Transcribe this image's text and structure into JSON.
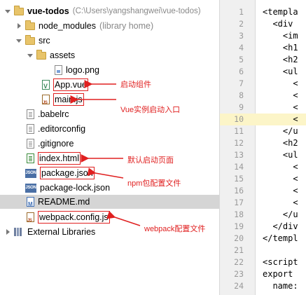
{
  "tree": {
    "project": {
      "name": "vue-todos",
      "path": "C:\\Users\\yangshangwei\\vue-todos"
    },
    "node_modules": {
      "name": "node_modules",
      "note": "library home"
    },
    "src": {
      "name": "src"
    },
    "assets": {
      "name": "assets"
    },
    "logo": {
      "name": "logo.png"
    },
    "app_vue": {
      "name": "App.vue"
    },
    "main_js": {
      "name": "main.js"
    },
    "babelrc": {
      "name": ".babelrc"
    },
    "editorconfig": {
      "name": ".editorconfig"
    },
    "gitignore": {
      "name": ".gitignore"
    },
    "index_html": {
      "name": "index.html"
    },
    "package_json": {
      "name": "package.json"
    },
    "package_lock": {
      "name": "package-lock.json"
    },
    "readme": {
      "name": "README.md"
    },
    "webpack_config": {
      "name": "webpack.config.js"
    },
    "external_libraries": {
      "name": "External Libraries"
    }
  },
  "annotations": {
    "app_vue": "启动组件",
    "main_js": "Vue实例启动入口",
    "index_html": "默认启动页面",
    "package_json": "npm包配置文件",
    "webpack_config": "webpack配置文件"
  },
  "editor": {
    "current_line": 10,
    "lines": [
      {
        "n": "1",
        "text": "<templa"
      },
      {
        "n": "2",
        "text": "  <div"
      },
      {
        "n": "3",
        "text": "    <im"
      },
      {
        "n": "4",
        "text": "    <h1"
      },
      {
        "n": "5",
        "text": "    <h2"
      },
      {
        "n": "6",
        "text": "    <ul"
      },
      {
        "n": "7",
        "text": "      <"
      },
      {
        "n": "8",
        "text": "      <"
      },
      {
        "n": "9",
        "text": "      <"
      },
      {
        "n": "10",
        "text": "      <"
      },
      {
        "n": "11",
        "text": "    </u"
      },
      {
        "n": "12",
        "text": "    <h2"
      },
      {
        "n": "13",
        "text": "    <ul"
      },
      {
        "n": "14",
        "text": "      <"
      },
      {
        "n": "15",
        "text": "      <"
      },
      {
        "n": "16",
        "text": "      <"
      },
      {
        "n": "17",
        "text": "      <"
      },
      {
        "n": "18",
        "text": "    </u"
      },
      {
        "n": "19",
        "text": "  </div"
      },
      {
        "n": "20",
        "text": "</templ"
      },
      {
        "n": "21",
        "text": ""
      },
      {
        "n": "22",
        "text": "<script"
      },
      {
        "n": "23",
        "text": "export "
      },
      {
        "n": "24",
        "text": "  name:"
      }
    ]
  }
}
